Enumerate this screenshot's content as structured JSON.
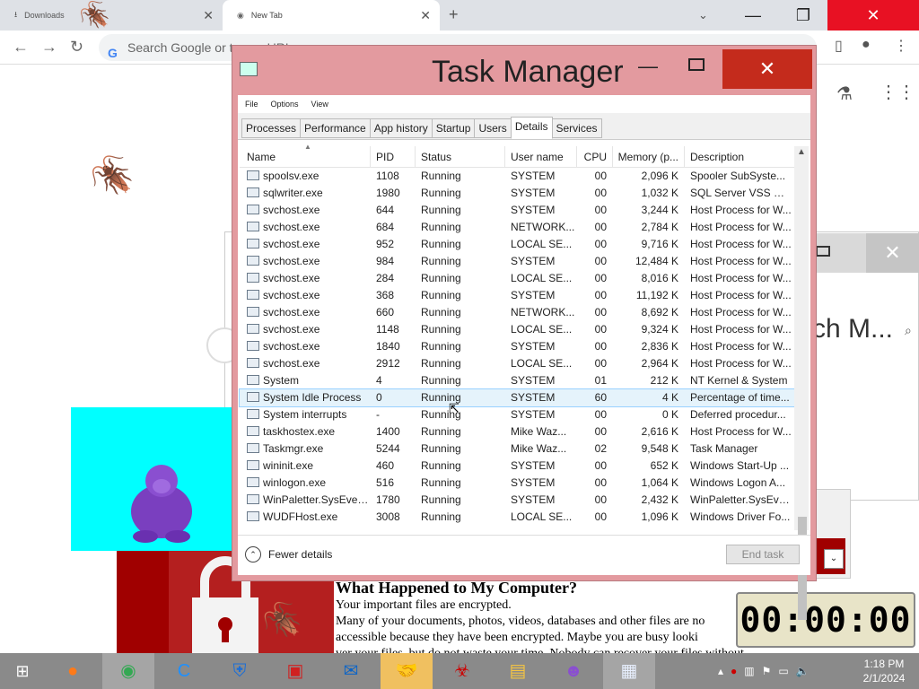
{
  "browser": {
    "tabs": [
      {
        "title": "Downloads"
      },
      {
        "title": "New Tab"
      }
    ],
    "omnibox_placeholder": "Search Google or type a URL"
  },
  "background": {
    "search_fragment": "ch M...",
    "ransom": {
      "heading": "What Happened to My Computer?",
      "lines": [
        "Your important files are encrypted.",
        "Many of your documents, photos, videos, databases and other files are no",
        "accessible because they have been encrypted. Maybe you are busy looki",
        "ver your files, but do not waste your time. Nobody can recover your files without"
      ]
    },
    "timer": "00:00:00"
  },
  "task_manager": {
    "title": "Task Manager",
    "menu": [
      "File",
      "Options",
      "View"
    ],
    "tabs": [
      "Processes",
      "Performance",
      "App history",
      "Startup",
      "Users",
      "Details",
      "Services"
    ],
    "active_tab": "Details",
    "columns": [
      "Name",
      "PID",
      "Status",
      "User name",
      "CPU",
      "Memory (p...",
      "Description"
    ],
    "rows": [
      {
        "name": "spoolsv.exe",
        "pid": "1108",
        "status": "Running",
        "user": "SYSTEM",
        "cpu": "00",
        "mem": "2,096 K",
        "desc": "Spooler SubSyste..."
      },
      {
        "name": "sqlwriter.exe",
        "pid": "1980",
        "status": "Running",
        "user": "SYSTEM",
        "cpu": "00",
        "mem": "1,032 K",
        "desc": "SQL Server VSS Wri..."
      },
      {
        "name": "svchost.exe",
        "pid": "644",
        "status": "Running",
        "user": "SYSTEM",
        "cpu": "00",
        "mem": "3,244 K",
        "desc": "Host Process for W..."
      },
      {
        "name": "svchost.exe",
        "pid": "684",
        "status": "Running",
        "user": "NETWORK...",
        "cpu": "00",
        "mem": "2,784 K",
        "desc": "Host Process for W..."
      },
      {
        "name": "svchost.exe",
        "pid": "952",
        "status": "Running",
        "user": "LOCAL SE...",
        "cpu": "00",
        "mem": "9,716 K",
        "desc": "Host Process for W..."
      },
      {
        "name": "svchost.exe",
        "pid": "984",
        "status": "Running",
        "user": "SYSTEM",
        "cpu": "00",
        "mem": "12,484 K",
        "desc": "Host Process for W..."
      },
      {
        "name": "svchost.exe",
        "pid": "284",
        "status": "Running",
        "user": "LOCAL SE...",
        "cpu": "00",
        "mem": "8,016 K",
        "desc": "Host Process for W..."
      },
      {
        "name": "svchost.exe",
        "pid": "368",
        "status": "Running",
        "user": "SYSTEM",
        "cpu": "00",
        "mem": "11,192 K",
        "desc": "Host Process for W..."
      },
      {
        "name": "svchost.exe",
        "pid": "660",
        "status": "Running",
        "user": "NETWORK...",
        "cpu": "00",
        "mem": "8,692 K",
        "desc": "Host Process for W..."
      },
      {
        "name": "svchost.exe",
        "pid": "1148",
        "status": "Running",
        "user": "LOCAL SE...",
        "cpu": "00",
        "mem": "9,324 K",
        "desc": "Host Process for W..."
      },
      {
        "name": "svchost.exe",
        "pid": "1840",
        "status": "Running",
        "user": "SYSTEM",
        "cpu": "00",
        "mem": "2,836 K",
        "desc": "Host Process for W..."
      },
      {
        "name": "svchost.exe",
        "pid": "2912",
        "status": "Running",
        "user": "LOCAL SE...",
        "cpu": "00",
        "mem": "2,964 K",
        "desc": "Host Process for W..."
      },
      {
        "name": "System",
        "pid": "4",
        "status": "Running",
        "user": "SYSTEM",
        "cpu": "01",
        "mem": "212 K",
        "desc": "NT Kernel & System"
      },
      {
        "name": "System Idle Process",
        "pid": "0",
        "status": "Running",
        "user": "SYSTEM",
        "cpu": "60",
        "mem": "4 K",
        "desc": "Percentage of time...",
        "selected": true
      },
      {
        "name": "System interrupts",
        "pid": "-",
        "status": "Running",
        "user": "SYSTEM",
        "cpu": "00",
        "mem": "0 K",
        "desc": "Deferred procedur..."
      },
      {
        "name": "taskhostex.exe",
        "pid": "1400",
        "status": "Running",
        "user": "Mike Waz...",
        "cpu": "00",
        "mem": "2,616 K",
        "desc": "Host Process for W..."
      },
      {
        "name": "Taskmgr.exe",
        "pid": "5244",
        "status": "Running",
        "user": "Mike Waz...",
        "cpu": "02",
        "mem": "9,548 K",
        "desc": "Task Manager"
      },
      {
        "name": "wininit.exe",
        "pid": "460",
        "status": "Running",
        "user": "SYSTEM",
        "cpu": "00",
        "mem": "652 K",
        "desc": "Windows Start-Up ..."
      },
      {
        "name": "winlogon.exe",
        "pid": "516",
        "status": "Running",
        "user": "SYSTEM",
        "cpu": "00",
        "mem": "1,064 K",
        "desc": "Windows Logon A..."
      },
      {
        "name": "WinPaletter.SysEvent...",
        "pid": "1780",
        "status": "Running",
        "user": "SYSTEM",
        "cpu": "00",
        "mem": "2,432 K",
        "desc": "WinPaletter.SysEve..."
      },
      {
        "name": "WUDFHost.exe",
        "pid": "3008",
        "status": "Running",
        "user": "LOCAL SE...",
        "cpu": "00",
        "mem": "1,096 K",
        "desc": "Windows Driver Fo..."
      }
    ],
    "fewer_details": "Fewer details",
    "end_task": "End task"
  },
  "taskbar": {
    "time": "1:18 PM",
    "date": "2/1/2024"
  },
  "colors": {
    "tm_frame": "#e39a9f",
    "close_red": "#c42b1c",
    "cyan": "#00ffff",
    "ransom_red": "#a00000",
    "taskbar": "#8a8a8a"
  }
}
